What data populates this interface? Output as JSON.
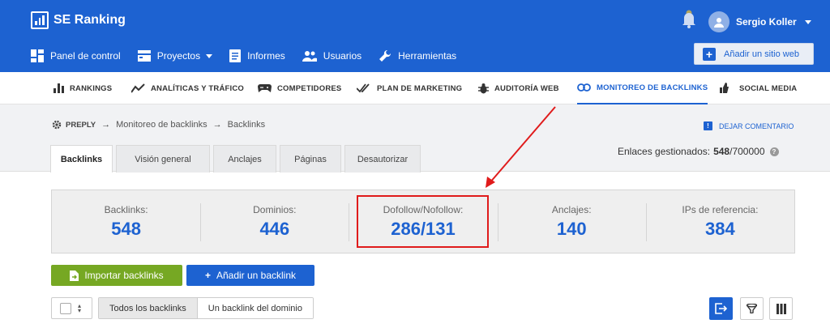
{
  "app": {
    "name": "SE Ranking"
  },
  "user": {
    "name": "Sergio Koller"
  },
  "main_nav": [
    {
      "label": "Panel de control",
      "icon": "dashboard-icon"
    },
    {
      "label": "Proyectos",
      "icon": "projects-icon",
      "has_dropdown": true
    },
    {
      "label": "Informes",
      "icon": "reports-icon"
    },
    {
      "label": "Usuarios",
      "icon": "users-icon"
    },
    {
      "label": "Herramientas",
      "icon": "wrench-icon"
    }
  ],
  "add_site_label": "Añadir un sitio web",
  "sub_nav": [
    {
      "label": "RANKINGS",
      "icon": "bar-chart-icon"
    },
    {
      "label": "ANALÍTICAS Y TRÁFICO",
      "icon": "trend-line-icon"
    },
    {
      "label": "COMPETIDORES",
      "icon": "gamepad-icon"
    },
    {
      "label": "PLAN DE MARKETING",
      "icon": "double-check-icon"
    },
    {
      "label": "AUDITORÍA WEB",
      "icon": "bug-icon"
    },
    {
      "label": "MONITOREO DE BACKLINKS",
      "icon": "link-icon",
      "active": true
    },
    {
      "label": "SOCIAL MEDIA",
      "icon": "thumbs-icon"
    }
  ],
  "breadcrumb": {
    "root": "PREPLY",
    "level1": "Monitoreo de backlinks",
    "level2": "Backlinks",
    "separator": "→"
  },
  "comment_label": "DEJAR COMENTARIO",
  "page_tabs": [
    {
      "label": "Backlinks",
      "active": true
    },
    {
      "label": "Visión general"
    },
    {
      "label": "Anclajes"
    },
    {
      "label": "Páginas"
    },
    {
      "label": "Desautorizar"
    }
  ],
  "managed": {
    "label": "Enlaces gestionados:",
    "used": "548",
    "total": "/700000"
  },
  "stats": [
    {
      "label": "Backlinks:",
      "value": "548"
    },
    {
      "label": "Dominios:",
      "value": "446"
    },
    {
      "label": "Dofollow/Nofollow:",
      "value": "286/131",
      "highlighted": true
    },
    {
      "label": "Anclajes:",
      "value": "140"
    },
    {
      "label": "IPs de referencia:",
      "value": "384"
    }
  ],
  "actions": {
    "import_label": "Importar backlinks",
    "add_label": "Añadir un backlink",
    "add_prefix": "+"
  },
  "filters": [
    {
      "label": "Todos los backlinks",
      "active": true
    },
    {
      "label": "Un backlink del dominio"
    }
  ],
  "colors": {
    "brand_blue": "#1d62d1",
    "green": "#76a823",
    "highlight_red": "#e01b1b"
  }
}
